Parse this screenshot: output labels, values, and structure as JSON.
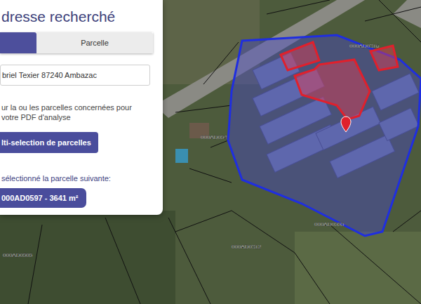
{
  "panel": {
    "title": "dresse recherché",
    "tabs": [
      {
        "label": "",
        "selected": true
      },
      {
        "label": "Parcelle",
        "selected": false
      }
    ],
    "address_field": {
      "value": "briel Texier 87240 Ambazac"
    },
    "instruction": [
      "ur la ou les parcelles concernées pour",
      "votre PDF d'analyse"
    ],
    "button": "lti-selection de parcelles",
    "selected_label": "sélectionné la parcelle suivante:",
    "selected_parcel": "000AD0597 - 3641 m²"
  },
  "map": {
    "parcels": [
      {
        "selected": false
      },
      {
        "selected": true
      },
      {
        "selected": true
      },
      {
        "selected": true
      }
    ],
    "labels": [
      "000AD0316",
      "000AD054",
      "000AD0555",
      "000AD0312",
      "000AD0505"
    ]
  }
}
